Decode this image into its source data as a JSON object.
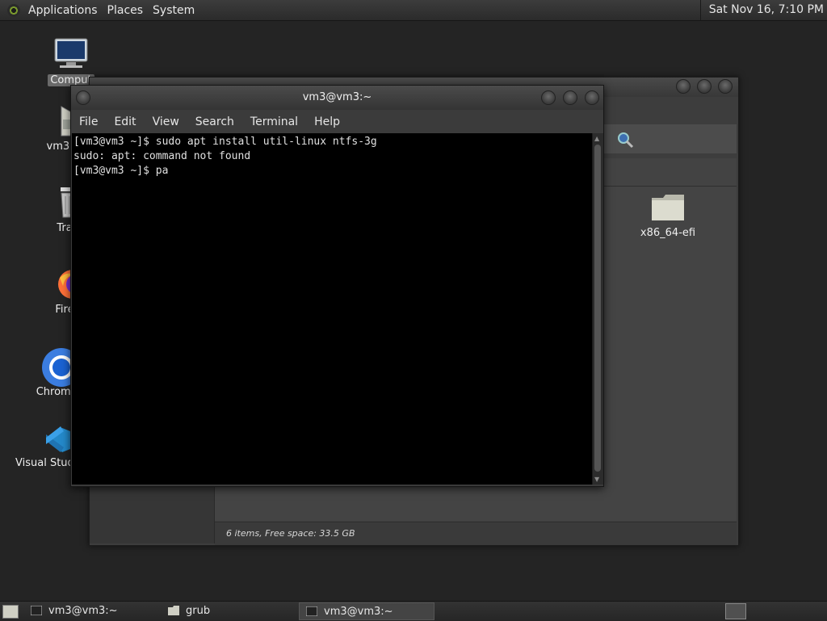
{
  "top_panel": {
    "menus": [
      "Applications",
      "Places",
      "System"
    ],
    "clock": "Sat Nov 16,  7:10 PM"
  },
  "desktop_icons": [
    {
      "label": "Comput",
      "icon": "computer-icon"
    },
    {
      "label": "vm3's",
      "icon": "home-folder-icon"
    },
    {
      "label": "Tra",
      "icon": "trash-icon"
    },
    {
      "label": "Fire",
      "icon": "firefox-icon"
    },
    {
      "label": "Chromi",
      "icon": "chromium-icon"
    },
    {
      "label": "Visual Studi",
      "icon": "vscode-icon"
    }
  ],
  "file_manager": {
    "folder_label": "x86_64-efi",
    "status": "6 items, Free space: 33.5 GB"
  },
  "terminal": {
    "title": "vm3@vm3:~",
    "menu": [
      "File",
      "Edit",
      "View",
      "Search",
      "Terminal",
      "Help"
    ],
    "lines": [
      "[vm3@vm3 ~]$ sudo apt install util-linux ntfs-3g",
      "sudo: apt: command not found",
      "[vm3@vm3 ~]$ pa"
    ]
  },
  "taskbar": {
    "tasks": [
      {
        "label": "vm3@vm3:~",
        "icon": "terminal-icon",
        "active": false
      },
      {
        "label": "grub",
        "icon": "folder-icon",
        "active": false
      },
      {
        "label": "vm3@vm3:~",
        "icon": "terminal-icon",
        "active": true
      }
    ]
  },
  "colors": {
    "terminal_bg": "#000000",
    "panel": "#2b2b2b",
    "desktop": "#242424"
  }
}
